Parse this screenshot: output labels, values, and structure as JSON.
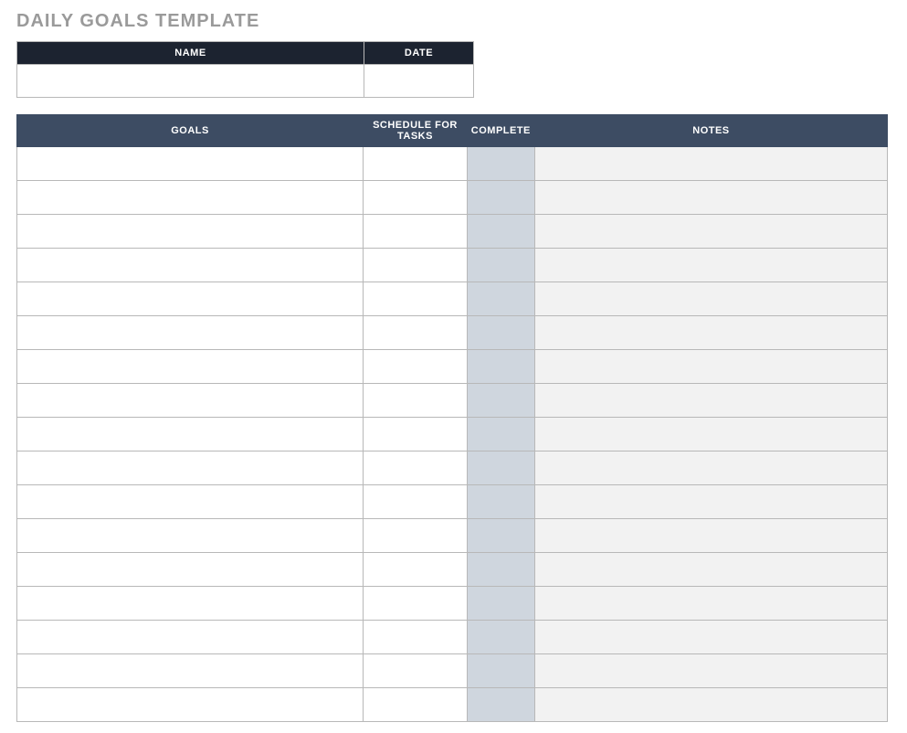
{
  "title": "DAILY GOALS TEMPLATE",
  "info_headers": {
    "name": "NAME",
    "date": "DATE"
  },
  "info_values": {
    "name": "",
    "date": ""
  },
  "goals_headers": {
    "goals": "GOALS",
    "schedule": "SCHEDULE FOR TASKS",
    "complete": "COMPLETE",
    "notes": "NOTES"
  },
  "rows": [
    {
      "goal": "",
      "schedule": "",
      "complete": "",
      "notes": ""
    },
    {
      "goal": "",
      "schedule": "",
      "complete": "",
      "notes": ""
    },
    {
      "goal": "",
      "schedule": "",
      "complete": "",
      "notes": ""
    },
    {
      "goal": "",
      "schedule": "",
      "complete": "",
      "notes": ""
    },
    {
      "goal": "",
      "schedule": "",
      "complete": "",
      "notes": ""
    },
    {
      "goal": "",
      "schedule": "",
      "complete": "",
      "notes": ""
    },
    {
      "goal": "",
      "schedule": "",
      "complete": "",
      "notes": ""
    },
    {
      "goal": "",
      "schedule": "",
      "complete": "",
      "notes": ""
    },
    {
      "goal": "",
      "schedule": "",
      "complete": "",
      "notes": ""
    },
    {
      "goal": "",
      "schedule": "",
      "complete": "",
      "notes": ""
    },
    {
      "goal": "",
      "schedule": "",
      "complete": "",
      "notes": ""
    },
    {
      "goal": "",
      "schedule": "",
      "complete": "",
      "notes": ""
    },
    {
      "goal": "",
      "schedule": "",
      "complete": "",
      "notes": ""
    },
    {
      "goal": "",
      "schedule": "",
      "complete": "",
      "notes": ""
    },
    {
      "goal": "",
      "schedule": "",
      "complete": "",
      "notes": ""
    },
    {
      "goal": "",
      "schedule": "",
      "complete": "",
      "notes": ""
    },
    {
      "goal": "",
      "schedule": "",
      "complete": "",
      "notes": ""
    }
  ]
}
